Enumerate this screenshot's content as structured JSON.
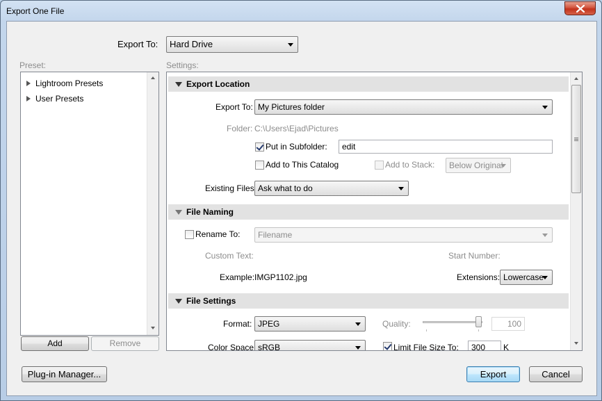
{
  "window": {
    "title": "Export One File"
  },
  "export_to": {
    "label": "Export To:",
    "value": "Hard Drive"
  },
  "preset": {
    "label": "Preset:",
    "items": [
      {
        "label": "Lightroom Presets"
      },
      {
        "label": "User Presets"
      }
    ],
    "add_label": "Add",
    "remove_label": "Remove"
  },
  "settings": {
    "label": "Settings:",
    "export_location": {
      "title": "Export Location",
      "export_to_label": "Export To:",
      "export_to_value": "My Pictures folder",
      "folder_label": "Folder:",
      "folder_value": "C:\\Users\\Ejad\\Pictures",
      "put_in_subfolder_label": "Put in Subfolder:",
      "put_in_subfolder_checked": true,
      "subfolder_value": "edit",
      "add_to_catalog_label": "Add to This Catalog",
      "add_to_stack_label": "Add to Stack:",
      "stack_position_value": "Below Original",
      "existing_files_label": "Existing Files:",
      "existing_files_value": "Ask what to do"
    },
    "file_naming": {
      "title": "File Naming",
      "rename_to_label": "Rename To:",
      "rename_template_value": "Filename",
      "custom_text_label": "Custom Text:",
      "start_number_label": "Start Number:",
      "example_label": "Example:",
      "example_value": "IMGP1102.jpg",
      "extensions_label": "Extensions:",
      "extensions_value": "Lowercase"
    },
    "file_settings": {
      "title": "File Settings",
      "format_label": "Format:",
      "format_value": "JPEG",
      "quality_label": "Quality:",
      "quality_value": "100",
      "color_space_label": "Color Space:",
      "color_space_value": "sRGB",
      "limit_size_label": "Limit File Size To:",
      "limit_size_checked": true,
      "limit_size_value": "300",
      "limit_size_unit": "K"
    }
  },
  "footer": {
    "plugin_manager_label": "Plug-in Manager...",
    "export_label": "Export",
    "cancel_label": "Cancel"
  },
  "colors": {
    "accent": "#3c7fb1",
    "close": "#c2321c",
    "section_bg": "#e2e2e2"
  },
  "icons": {
    "close": "close-icon",
    "expand": "triangle-right-icon",
    "collapse": "triangle-down-icon",
    "dropdown": "chevron-down-icon"
  }
}
